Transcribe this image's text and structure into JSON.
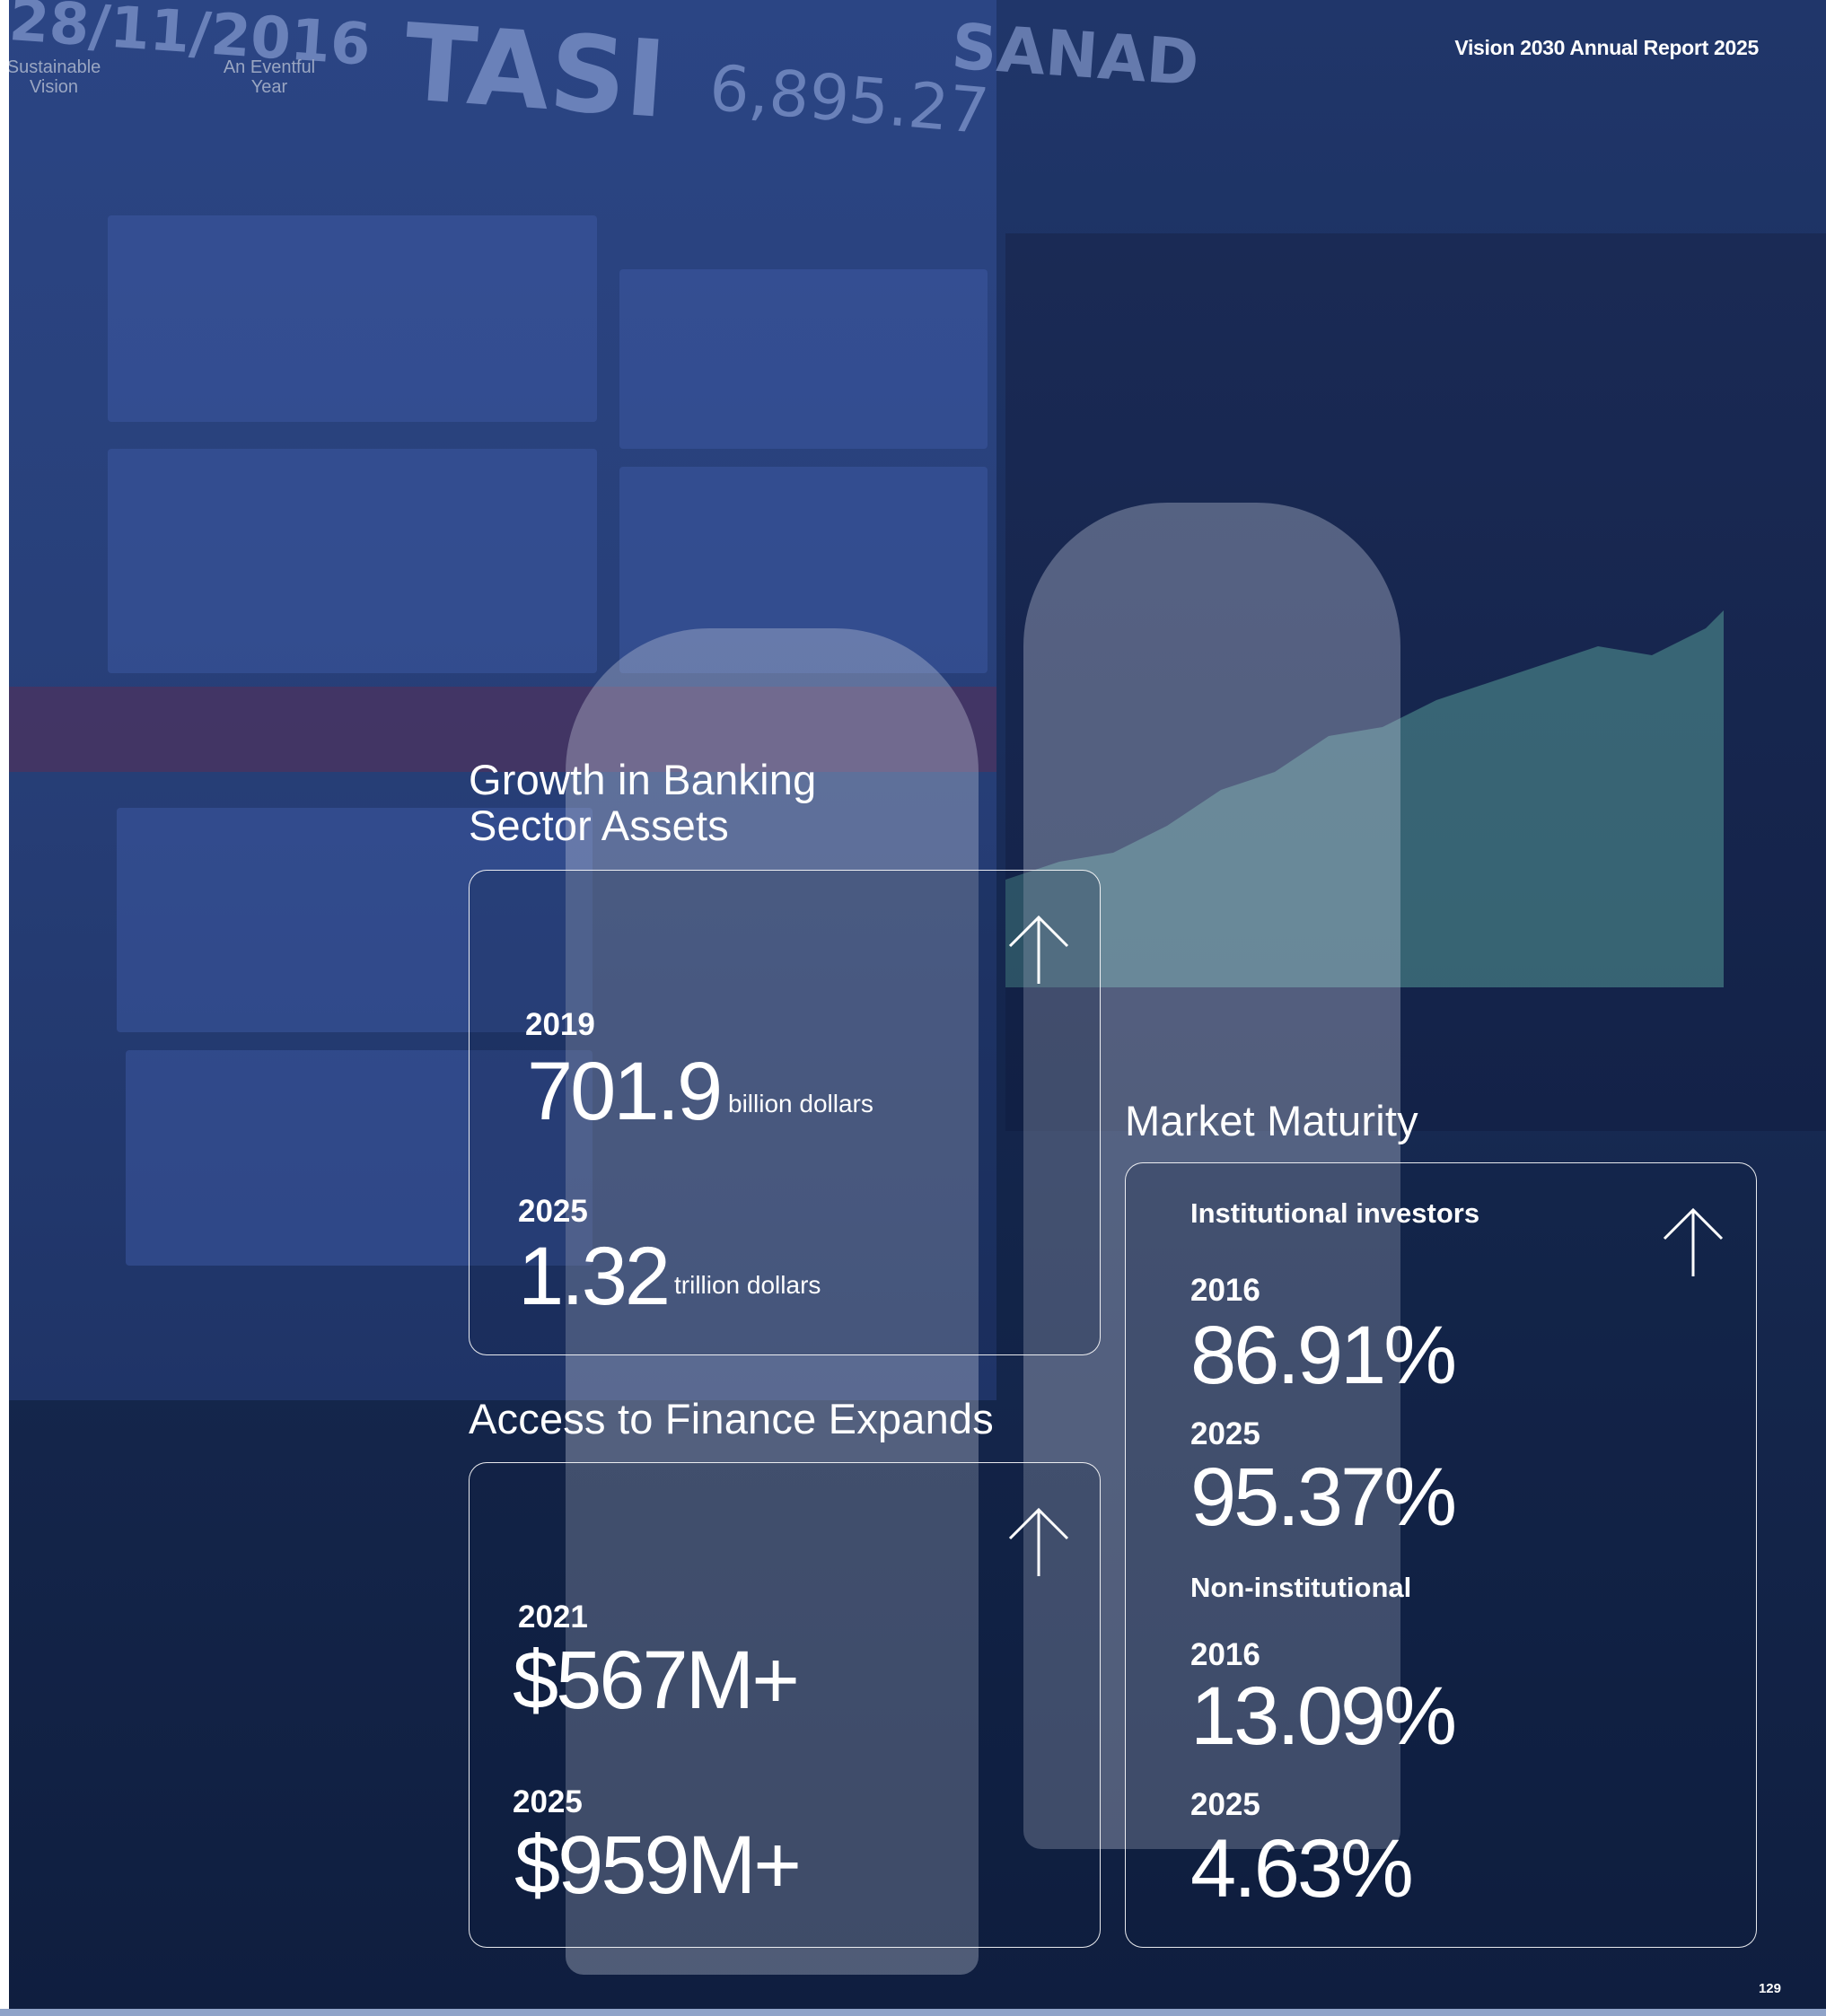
{
  "header": {
    "nav": [
      "Sustainable Vision",
      "An Eventful Year"
    ],
    "report_title": "Vision 2030 Annual Report 2025",
    "page_number": "129"
  },
  "background": {
    "date_text": "28/11/2016",
    "index_name": "TASI",
    "index_value": "6,895.27",
    "brand": "SANAD"
  },
  "banking": {
    "title_line1": "Growth in Banking",
    "title_line2": "Sector Assets",
    "entries": [
      {
        "year": "2019",
        "value": "701.9",
        "unit": "billion dollars"
      },
      {
        "year": "2025",
        "value": "1.32",
        "unit": "trillion dollars"
      }
    ]
  },
  "finance": {
    "title": "Access to Finance Expands",
    "entries": [
      {
        "year": "2021",
        "value": "$567M+"
      },
      {
        "year": "2025",
        "value": "$959M+"
      }
    ]
  },
  "market": {
    "title": "Market Maturity",
    "institutional": {
      "label": "Institutional investors",
      "entries": [
        {
          "year": "2016",
          "value": "86.91%"
        },
        {
          "year": "2025",
          "value": "95.37%"
        }
      ]
    },
    "non_institutional": {
      "label": "Non-institutional",
      "entries": [
        {
          "year": "2016",
          "value": "13.09%"
        },
        {
          "year": "2025",
          "value": "4.63%"
        }
      ]
    }
  }
}
